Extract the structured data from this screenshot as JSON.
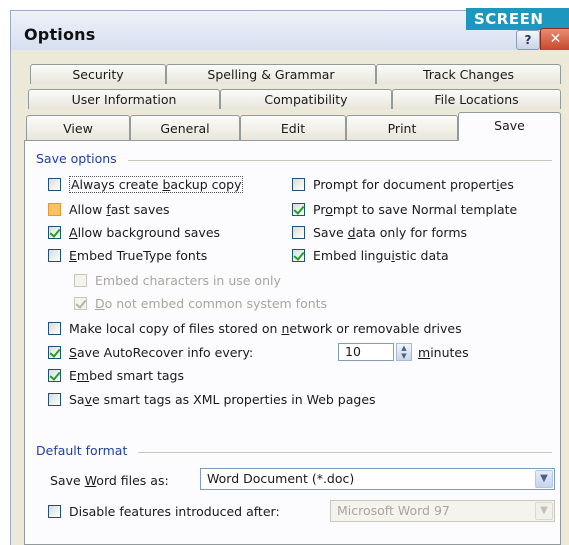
{
  "window": {
    "title": "Options",
    "badge": "SCREEN"
  },
  "tabs_row1": [
    "Security",
    "Spelling & Grammar",
    "Track Changes"
  ],
  "tabs_row2": [
    "User Information",
    "Compatibility",
    "File Locations"
  ],
  "tabs_row3": [
    "View",
    "General",
    "Edit",
    "Print",
    "Save"
  ],
  "save_options": {
    "title": "Save options",
    "left": [
      {
        "pre": "Always create ",
        "u": "b",
        "post": "ackup copy",
        "checked": false
      },
      {
        "pre": "Allow ",
        "u": "f",
        "post": "ast saves",
        "checked": false
      },
      {
        "pre": "",
        "u": "A",
        "post": "llow background saves",
        "checked": true
      },
      {
        "pre": "",
        "u": "E",
        "post": "mbed TrueType fonts",
        "checked": false
      }
    ],
    "right": [
      {
        "pre": "Prompt for document propert",
        "u": "i",
        "post": "es",
        "checked": false
      },
      {
        "pre": "Pr",
        "u": "o",
        "post": "mpt to save Normal template",
        "checked": true
      },
      {
        "pre": "Save ",
        "u": "d",
        "post": "ata only for forms",
        "checked": false
      },
      {
        "pre": "Embed lingu",
        "u": "i",
        "post": "stic data",
        "checked": true
      }
    ],
    "sub": [
      {
        "text": "Embed characters in use only",
        "checked": false
      },
      {
        "pre": "",
        "u": "D",
        "post": "o not embed common system fonts",
        "checked": true
      }
    ],
    "bottom": [
      {
        "pre": "Make local copy of files stored on ",
        "u": "n",
        "post": "etwork or removable drives",
        "checked": false
      },
      {
        "pre": "",
        "u": "S",
        "post": "ave AutoRecover info every:",
        "checked": true
      },
      {
        "pre": "E",
        "u": "m",
        "post": "bed smart tags",
        "checked": true
      },
      {
        "pre": "Sa",
        "u": "v",
        "post": "e smart tags as XML properties in Web pages",
        "checked": false
      }
    ],
    "autorecover_value": "10",
    "minutes_u": "m",
    "minutes_rest": "inutes"
  },
  "default_format": {
    "title": "Default format",
    "save_as_pre": "Save ",
    "save_as_u": "W",
    "save_as_post": "ord files as:",
    "save_as_value": "Word Document (*.doc)",
    "disable_label": "Disable features introduced after:",
    "disable_checked": false,
    "disable_value": "Microsoft Word 97"
  }
}
